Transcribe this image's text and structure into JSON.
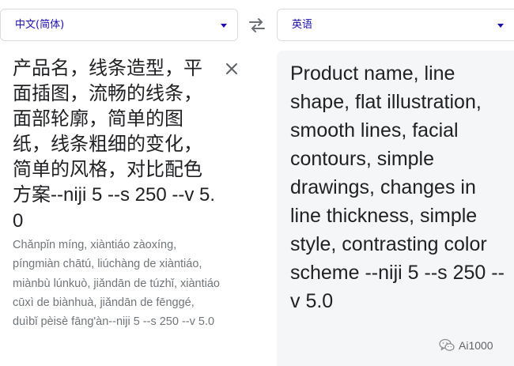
{
  "source_language": {
    "label": "中文(简体)"
  },
  "target_language": {
    "label": "英语"
  },
  "source": {
    "text": "产品名，线条造型，平面插图，流畅的线条，面部轮廓，简单的图纸，线条粗细的变化，简单的风格，对比配色方案",
    "text_suffix": "--niji 5 --s 250 --v 5.0",
    "romanization": "Chǎnpǐn míng, xiàntiáo zàoxíng, píngmiàn chātú, liúchàng de xiàntiáo, miànbù lúnkuò, jiǎndān de túzhǐ, xiàntiáo cūxì de biànhuà, jiǎndān de fēnggé, duìbǐ pèisè fāng'àn--niji 5 --s 250 --v 5.0"
  },
  "translation": {
    "text": "Product name, line shape, flat illustration, smooth lines, facial contours, simple drawings, changes in line thickness, simple style, contrasting color scheme --niji 5 --s 250 --v 5.0"
  },
  "icons": {
    "swap": "swap-languages-icon",
    "clear": "clear-icon",
    "source_dropdown": "chevron-down-icon",
    "target_dropdown": "chevron-down-icon",
    "watermark": "wechat-logo-icon"
  },
  "watermark": {
    "text": "Ai1000"
  },
  "colors": {
    "accent": "#1a0dab",
    "text": "#202124",
    "secondary_text": "#70757a",
    "target_background": "#f5f6f8",
    "border": "#dadce0"
  }
}
